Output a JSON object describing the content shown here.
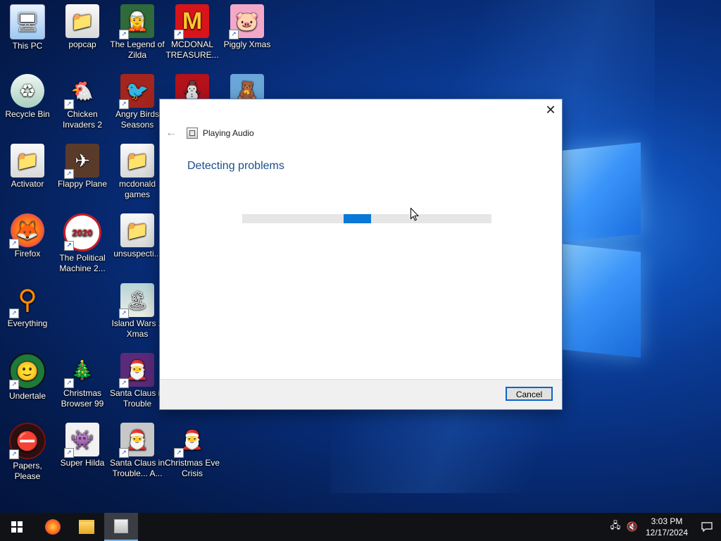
{
  "desktop": {
    "icons": [
      {
        "label": "This PC",
        "icon": "computer-icon"
      },
      {
        "label": "popcap",
        "icon": "folder-icon"
      },
      {
        "label": "The Legend of Zilda",
        "icon": "game-icon"
      },
      {
        "label": "MCDONAL TREASURE...",
        "icon": "mcdonalds-icon"
      },
      {
        "label": "Piggly Xmas",
        "icon": "pig-icon"
      },
      {
        "label": "Recycle Bin",
        "icon": "recycle-bin-icon"
      },
      {
        "label": "Chicken Invaders 2",
        "icon": "chicken-icon"
      },
      {
        "label": "Angry Birds Seasons",
        "icon": "angry-birds-icon"
      },
      {
        "label": "Activator",
        "icon": "folder-icon"
      },
      {
        "label": "Flappy Plane",
        "icon": "game-icon"
      },
      {
        "label": "mcdonald games",
        "icon": "folder-icon"
      },
      {
        "label": "Firefox",
        "icon": "firefox-icon"
      },
      {
        "label": "The Political Machine 2...",
        "icon": "political-machine-icon"
      },
      {
        "label": "unsuspecti...",
        "icon": "folder-icon"
      },
      {
        "label": "Everything",
        "icon": "search-icon"
      },
      {
        "label": "Island Wars 2 Xmas",
        "icon": "game-icon"
      },
      {
        "label": "Undertale",
        "icon": "undertale-icon"
      },
      {
        "label": "Christmas Browser 99",
        "icon": "christmas-tree-icon"
      },
      {
        "label": "Santa Claus in Trouble",
        "icon": "santa-icon"
      },
      {
        "label": "Papers, Please",
        "icon": "papers-please-icon"
      },
      {
        "label": "Super Hilda",
        "icon": "game-icon"
      },
      {
        "label": "Santa Claus in Trouble... A...",
        "icon": "santa-icon"
      },
      {
        "label": "Christmas Eve Crisis",
        "icon": "santa-icon"
      }
    ]
  },
  "dialog": {
    "nav_title": "Playing Audio",
    "heading": "Detecting problems",
    "progress_fraction": 0.11,
    "cancel_label": "Cancel",
    "close_glyph": "✕",
    "back_glyph": "←"
  },
  "taskbar": {
    "time": "3:03 PM",
    "date": "12/17/2024"
  },
  "colors": {
    "accent": "#0a78d7",
    "heading": "#1c4e8a",
    "taskbar": "#101216"
  }
}
